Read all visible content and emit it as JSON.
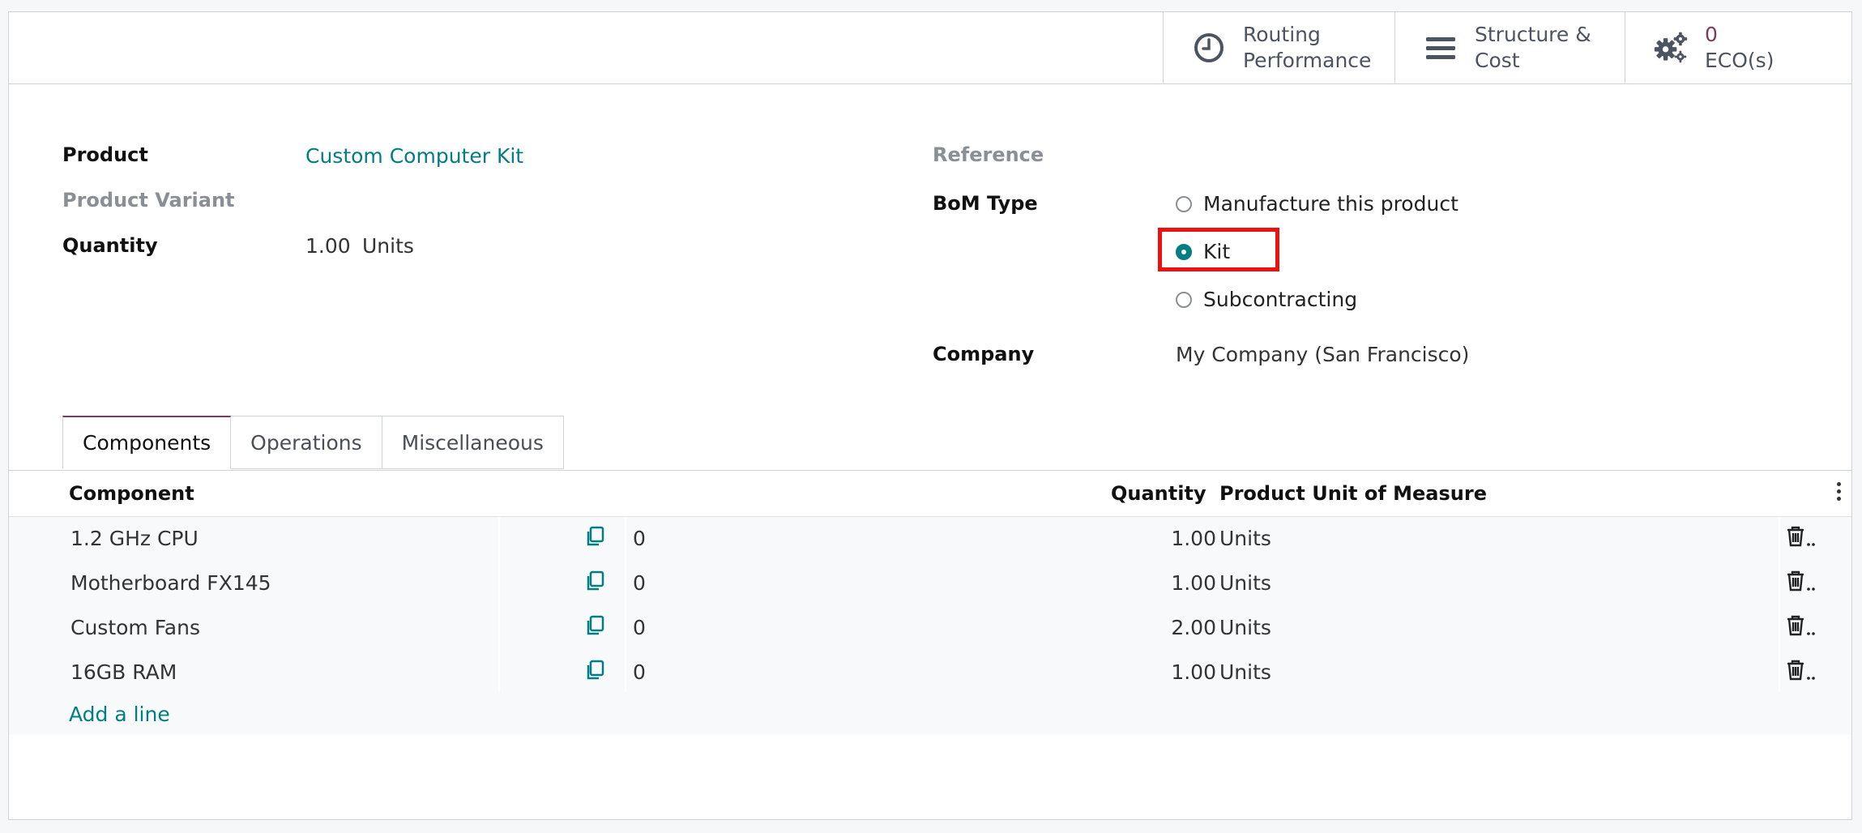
{
  "smart_buttons": {
    "routing": {
      "line1": "Routing",
      "line2": "Performance"
    },
    "structure": {
      "line1": "Structure &",
      "line2": "Cost"
    },
    "eco": {
      "count": "0",
      "label": "ECO(s)"
    }
  },
  "form": {
    "product_label": "Product",
    "product_value": "Custom Computer Kit",
    "variant_label": "Product Variant",
    "quantity_label": "Quantity",
    "quantity_value": "1.00",
    "quantity_uom": "Units",
    "reference_label": "Reference",
    "bom_type_label": "BoM Type",
    "bom_type_options": [
      "Manufacture this product",
      "Kit",
      "Subcontracting"
    ],
    "bom_type_selected": "Kit",
    "company_label": "Company",
    "company_value": "My Company (San Francisco)"
  },
  "tabs": [
    "Components",
    "Operations",
    "Miscellaneous"
  ],
  "table": {
    "headers": {
      "component": "Component",
      "quantity": "Quantity",
      "uom": "Product Unit of Measure"
    },
    "rows": [
      {
        "component": "1.2 GHz CPU",
        "count": "0",
        "quantity": "1.00",
        "uom": "Units"
      },
      {
        "component": "Motherboard FX145",
        "count": "0",
        "quantity": "1.00",
        "uom": "Units"
      },
      {
        "component": "Custom Fans",
        "count": "0",
        "quantity": "2.00",
        "uom": "Units"
      },
      {
        "component": "16GB RAM",
        "count": "0",
        "quantity": "1.00",
        "uom": "Units"
      }
    ],
    "add_line": "Add a line"
  },
  "colors": {
    "accent": "#017e84",
    "brand": "#7a3b5e",
    "highlight": "#ee1111"
  }
}
